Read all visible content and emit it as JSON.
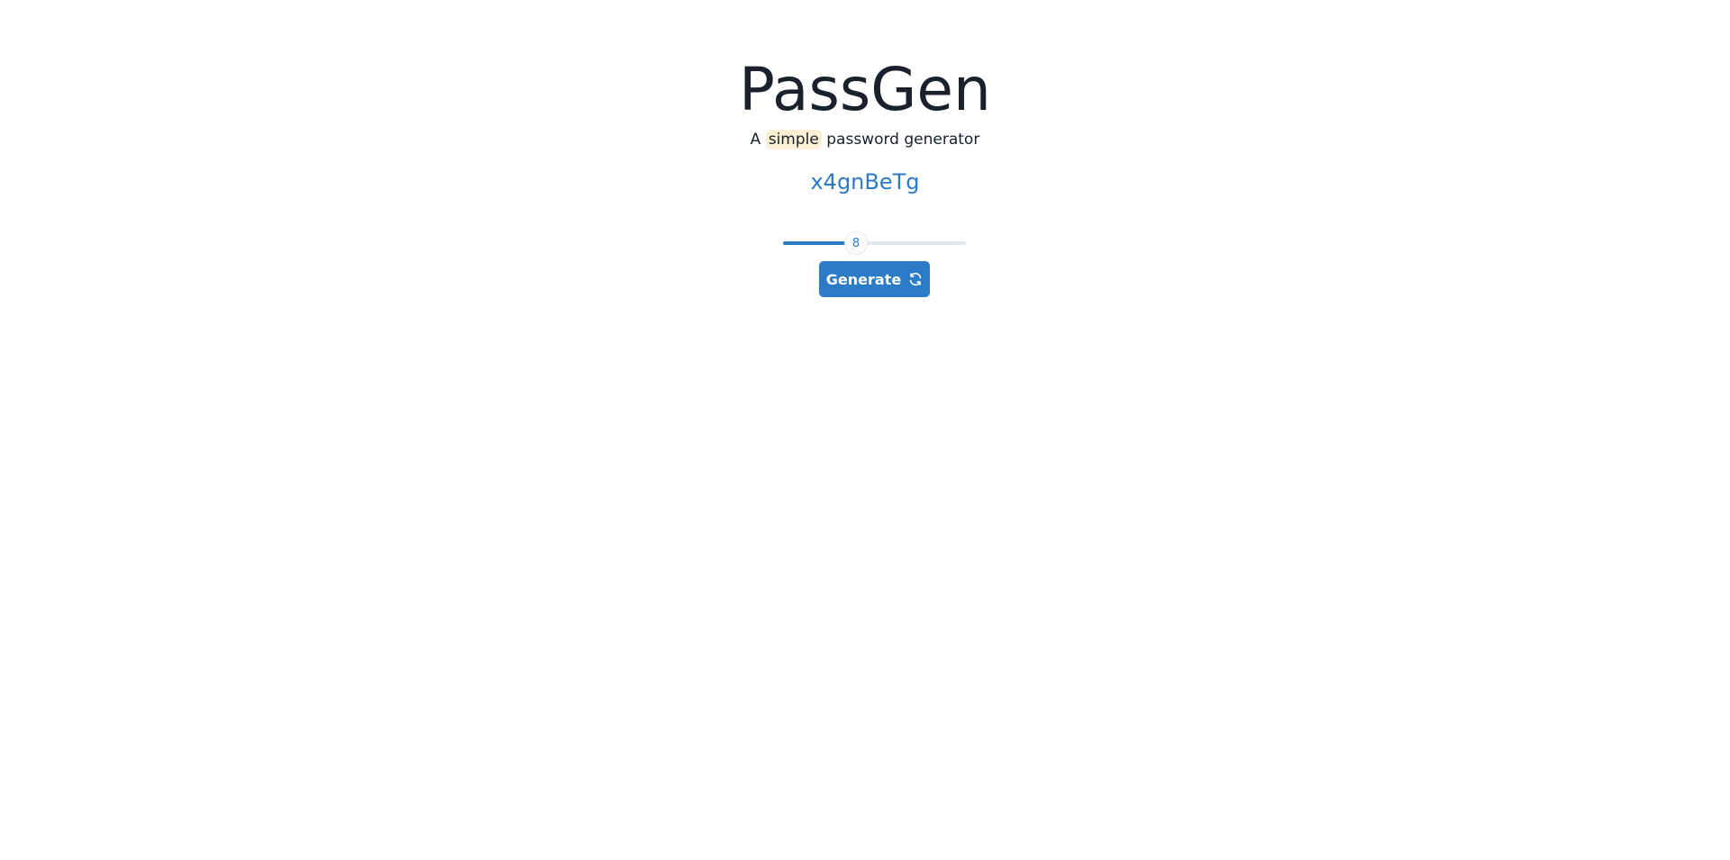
{
  "app": {
    "title": "PassGen",
    "subtitle": {
      "prefix": "A ",
      "highlight": "simple",
      "suffix": " password generator"
    },
    "password": "x4gnBeTg"
  },
  "length_slider": {
    "value": 8,
    "value_label": "8",
    "fraction": 0.4
  },
  "generate_button": {
    "label": "Generate",
    "icon": "refresh-icon"
  },
  "colors": {
    "accent": "#2b7bc6",
    "text": "#1a202c",
    "highlight_bg": "#fdf0d5",
    "track": "#e2e8f0"
  }
}
